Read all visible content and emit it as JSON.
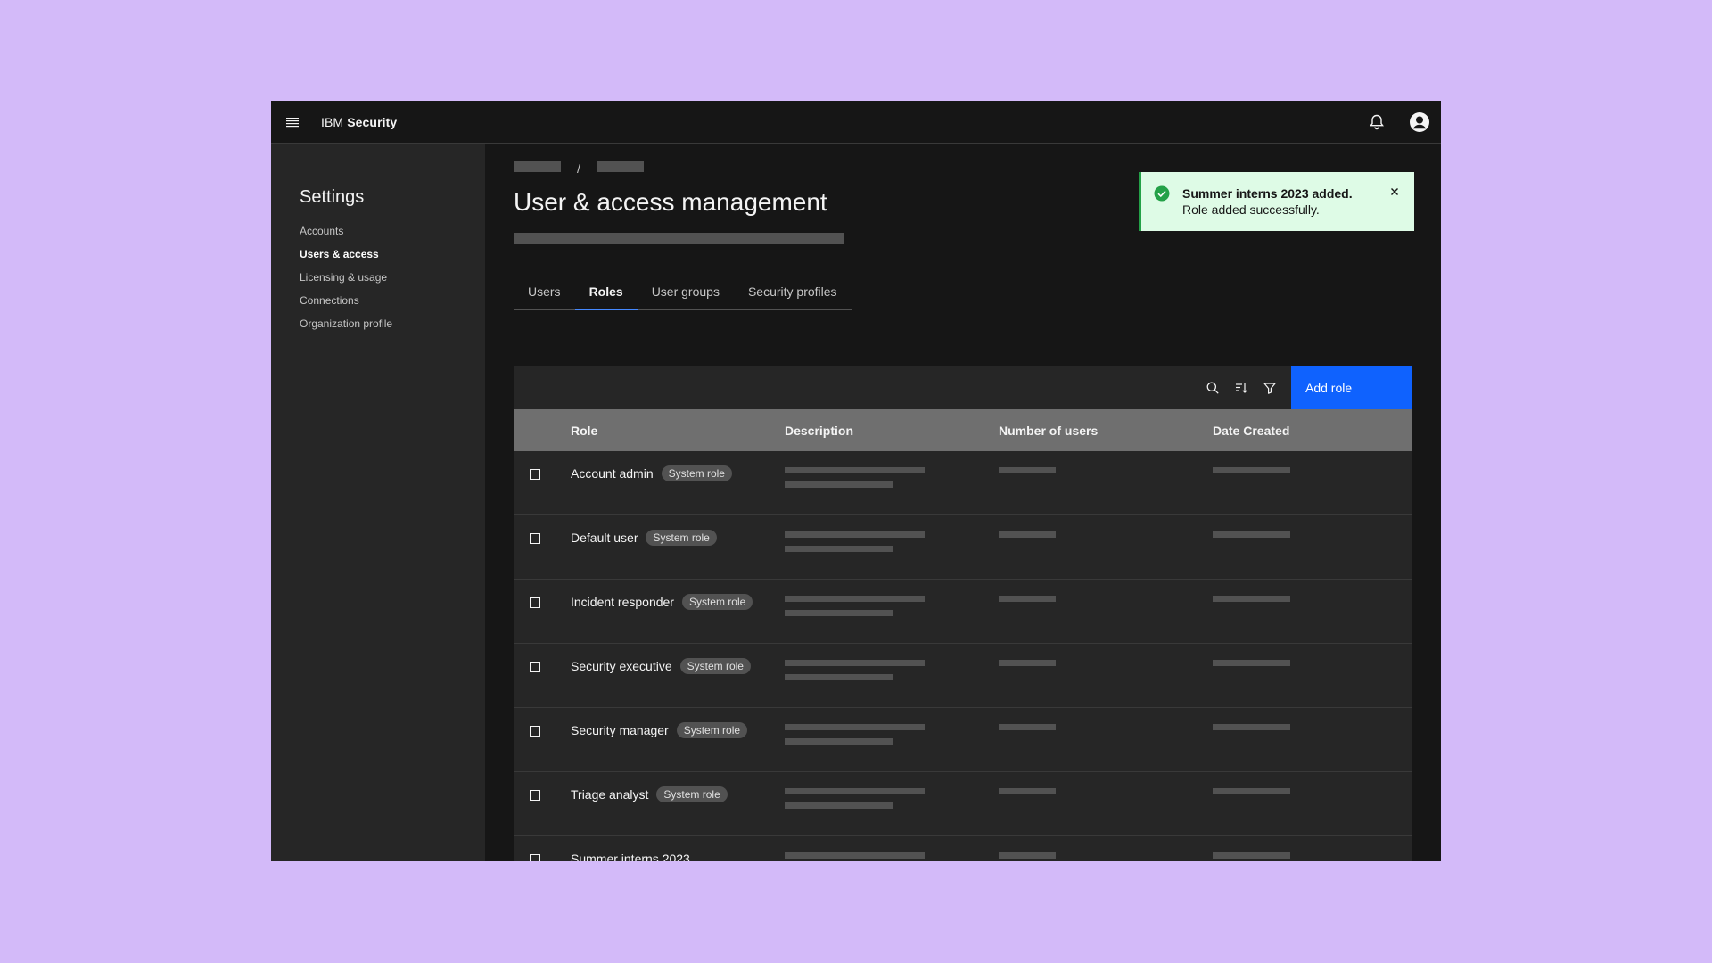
{
  "header": {
    "brand_prefix": "IBM",
    "brand_bold": "Security"
  },
  "sidebar": {
    "title": "Settings",
    "items": [
      {
        "label": "Accounts",
        "active": false
      },
      {
        "label": "Users & access",
        "active": true
      },
      {
        "label": "Licensing & usage",
        "active": false
      },
      {
        "label": "Connections",
        "active": false
      },
      {
        "label": "Organization profile",
        "active": false
      }
    ]
  },
  "main": {
    "breadcrumb_separator": "/",
    "title": "User & access management",
    "tabs": [
      {
        "label": "Users",
        "active": false
      },
      {
        "label": "Roles",
        "active": true
      },
      {
        "label": "User groups",
        "active": false
      },
      {
        "label": "Security profiles",
        "active": false
      }
    ]
  },
  "toolbar": {
    "search_icon": "search-icon",
    "sort_icon": "sort-icon",
    "filter_icon": "filter-icon",
    "add_label": "Add role"
  },
  "table": {
    "headers": [
      "Role",
      "Description",
      "Number of users",
      "Date Created"
    ],
    "rows": [
      {
        "role": "Account admin",
        "tag": "System role"
      },
      {
        "role": "Default user",
        "tag": "System role"
      },
      {
        "role": "Incident responder",
        "tag": "System role"
      },
      {
        "role": "Security executive",
        "tag": "System role"
      },
      {
        "role": "Security manager",
        "tag": "System role"
      },
      {
        "role": "Triage analyst",
        "tag": "System role"
      },
      {
        "role": "Summer interns 2023",
        "tag": ""
      }
    ]
  },
  "toast": {
    "title": "Summer interns 2023 added.",
    "subtitle": "Role added successfully.",
    "accent": "#24a148",
    "background": "#defbe6"
  },
  "colors": {
    "page_background": "#d3baf9",
    "primary_button": "#0f62fe",
    "active_tab_indicator": "#4589ff"
  }
}
